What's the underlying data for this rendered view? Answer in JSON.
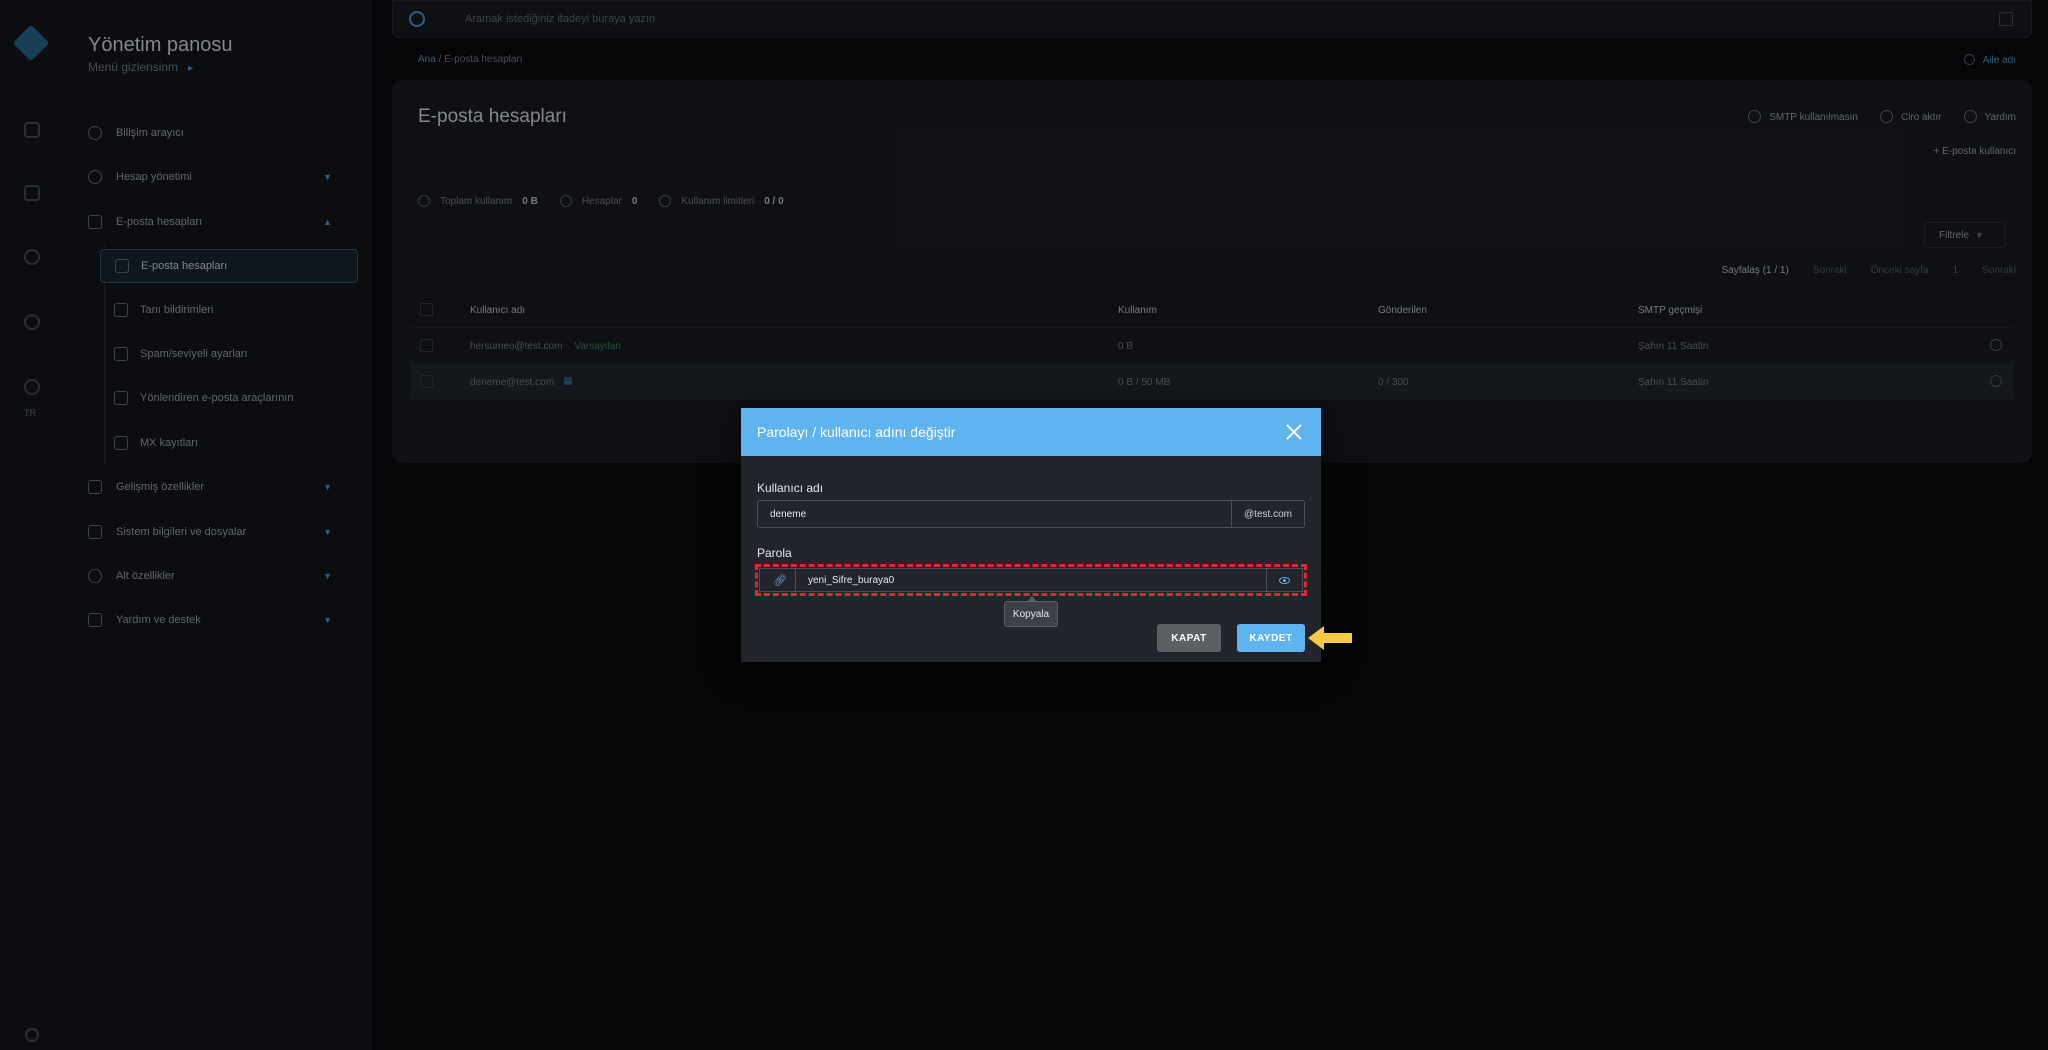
{
  "sidebar": {
    "title": "Yönetim panosu",
    "subtitle": "Menü gizlensinm",
    "items": [
      {
        "label": "Bilişim arayıcı"
      },
      {
        "label": "Hesap yönetimi"
      },
      {
        "label": "E-posta hesapları"
      },
      {
        "label": "E-posta hesapları"
      },
      {
        "label": "Tanı bildirimleri"
      },
      {
        "label": "Spam/seviyeli ayarları"
      },
      {
        "label": "Yönlendiren e-posta araçlarının"
      },
      {
        "label": "MX kayıtları"
      },
      {
        "label": "Gelişmiş özellikler"
      },
      {
        "label": "Sistem bilgileri ve dosyalar"
      },
      {
        "label": "Alt özellikler"
      },
      {
        "label": "Yardım ve destek"
      }
    ],
    "rail_label": "TR"
  },
  "topbar": {
    "search_placeholder": "Aramak istediğiniz ifadeyi buraya yazın",
    "breadcrumb_home": "Ana",
    "breadcrumb_current": "E-posta hesapları",
    "language": "Aile adı"
  },
  "card": {
    "title": "E-posta hesapları",
    "actions": [
      "SMTP kullanılmasın",
      "Ciro aktır",
      "Yardım"
    ],
    "new_account": "+ E-posta kullanıcı",
    "stats": [
      {
        "label": "Toplam kullanım",
        "value": "0 B"
      },
      {
        "label": "Hesaplar",
        "value": "0"
      },
      {
        "label": "Kullanım limitleri",
        "value": "0 / 0"
      }
    ],
    "filter_label": "Filtrele",
    "pager": {
      "current": "Sayfalaş (1 / 1)",
      "items": [
        "Sonraki",
        "Önceki sayfa",
        "1",
        "Sonraki"
      ]
    },
    "columns": [
      "Kullanıcı adı",
      "Kullanım",
      "Gönderilen",
      "SMTP geçmişi"
    ],
    "rows": [
      {
        "user": "hersumeo@test.com",
        "tag": "Varsayılan",
        "usage": "0 B",
        "sent": "",
        "smtp": "Şahın 11 Saatin"
      },
      {
        "user": "deneme@test.com",
        "tag": "",
        "usage": "0 B / 50 MB",
        "sent": "0 / 300",
        "smtp": "Şahın 11 Saatin"
      }
    ]
  },
  "modal": {
    "title": "Parolayı / kullanıcı adını değiştir",
    "username_label": "Kullanıcı adı",
    "username_value": "deneme",
    "domain_suffix": "@test.com",
    "password_label": "Parola",
    "password_value": "yeni_Sifre_buraya0",
    "copy_tooltip": "Kopyala",
    "cancel_label": "KAPAT",
    "save_label": "KAYDET"
  },
  "colors": {
    "accent": "#5fb3ef",
    "highlight_border": "#e3262b",
    "pointer_arrow": "#f6c844",
    "cancel_button": "#5c5f63"
  },
  "icons": {
    "copy": "link-icon",
    "toggle_visibility": "eye-icon",
    "close": "close-icon",
    "pointer": "arrow-left-icon"
  }
}
